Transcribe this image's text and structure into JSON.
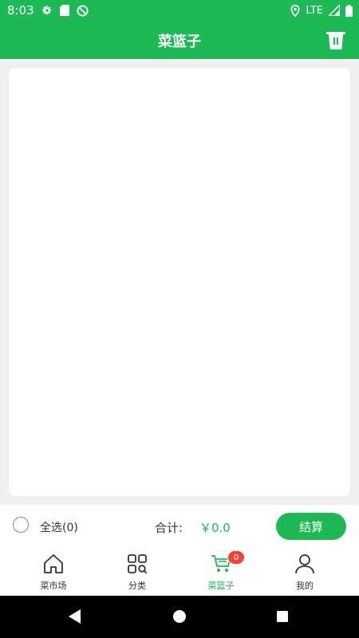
{
  "status_bar": {
    "time": "8:03",
    "network": "LTE",
    "icons_left": [
      "gear-icon",
      "sd-card-icon",
      "no-sync-icon"
    ],
    "icons_right": [
      "location-icon",
      "lte-signal-icon",
      "battery-icon"
    ]
  },
  "app_bar": {
    "title": "菜篮子",
    "action_icon": "trash-icon"
  },
  "cart": {
    "items": []
  },
  "checkout": {
    "select_all_label": "全选(0)",
    "total_label": "合计:",
    "total_value": "￥0.0",
    "checkout_button": "结算"
  },
  "tab_bar": {
    "tabs": [
      {
        "label": "菜市场",
        "icon": "home-icon",
        "active": false
      },
      {
        "label": "分类",
        "icon": "category-grid-icon",
        "active": false
      },
      {
        "label": "菜篮子",
        "icon": "cart-icon",
        "active": true,
        "badge": "0"
      },
      {
        "label": "我的",
        "icon": "profile-icon",
        "active": false
      }
    ]
  },
  "colors": {
    "primary": "#1db954",
    "badge": "#f44336",
    "background": "#efefef"
  }
}
